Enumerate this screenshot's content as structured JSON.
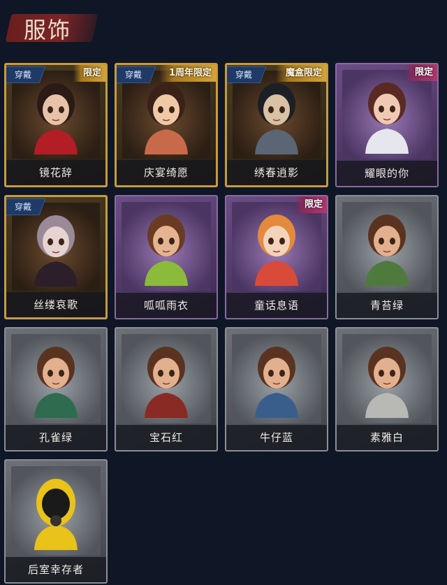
{
  "page": {
    "title": "服饰"
  },
  "badges": {
    "wear": "穿戴"
  },
  "items": [
    {
      "name": "镜花辞",
      "frame": "gold",
      "tag": "限定",
      "worn": true,
      "face": "#e6c3a8",
      "hair": "#2b1a15",
      "outfit": "#b21d26"
    },
    {
      "name": "庆宴绮愿",
      "frame": "gold",
      "tag": "1周年限定",
      "worn": true,
      "face": "#efc9a6",
      "hair": "#3a2218",
      "outfit": "#c86a4a"
    },
    {
      "name": "绣春逍影",
      "frame": "gold",
      "tag": "魔盒限定",
      "worn": true,
      "face": "#d8c1a4",
      "hair": "#1c1f26",
      "outfit": "#5b6574"
    },
    {
      "name": "耀眼的你",
      "frame": "purple",
      "tag": "限定",
      "worn": false,
      "face": "#f0c9b4",
      "hair": "#5a2a22",
      "outfit": "#e6e6ee"
    },
    {
      "name": "丝缕哀歌",
      "frame": "gold",
      "tag": "",
      "worn": true,
      "face": "#e7d3cf",
      "hair": "#9a8a98",
      "outfit": "#2c1f2a"
    },
    {
      "name": "呱呱雨衣",
      "frame": "purple",
      "tag": "",
      "worn": false,
      "face": "#e3b48f",
      "hair": "#6a3b22",
      "outfit": "#8cba3a"
    },
    {
      "name": "童话息语",
      "frame": "purple",
      "tag": "限定",
      "worn": false,
      "face": "#f4d3bc",
      "hair": "#e38a3c",
      "outfit": "#d84a3a"
    },
    {
      "name": "青苔绿",
      "frame": "silver",
      "tag": "",
      "worn": false,
      "face": "#e2b08e",
      "hair": "#5a3320",
      "outfit": "#4f7a3e"
    },
    {
      "name": "孔雀绿",
      "frame": "silver",
      "tag": "",
      "worn": false,
      "face": "#e2b08e",
      "hair": "#5a3320",
      "outfit": "#2f6b4e"
    },
    {
      "name": "宝石红",
      "frame": "silver",
      "tag": "",
      "worn": false,
      "face": "#e2b08e",
      "hair": "#5a3320",
      "outfit": "#8a2a24"
    },
    {
      "name": "牛仔蓝",
      "frame": "silver",
      "tag": "",
      "worn": false,
      "face": "#e2b08e",
      "hair": "#5a3320",
      "outfit": "#3a5e8c"
    },
    {
      "name": "素雅白",
      "frame": "silver",
      "tag": "",
      "worn": false,
      "face": "#e2b08e",
      "hair": "#5a3320",
      "outfit": "#b8b8b4"
    },
    {
      "name": "后室幸存者",
      "frame": "silver",
      "tag": "",
      "worn": false,
      "face": "#1a1a1a",
      "hair": "#e9c21a",
      "outfit": "#e9c21a"
    }
  ]
}
